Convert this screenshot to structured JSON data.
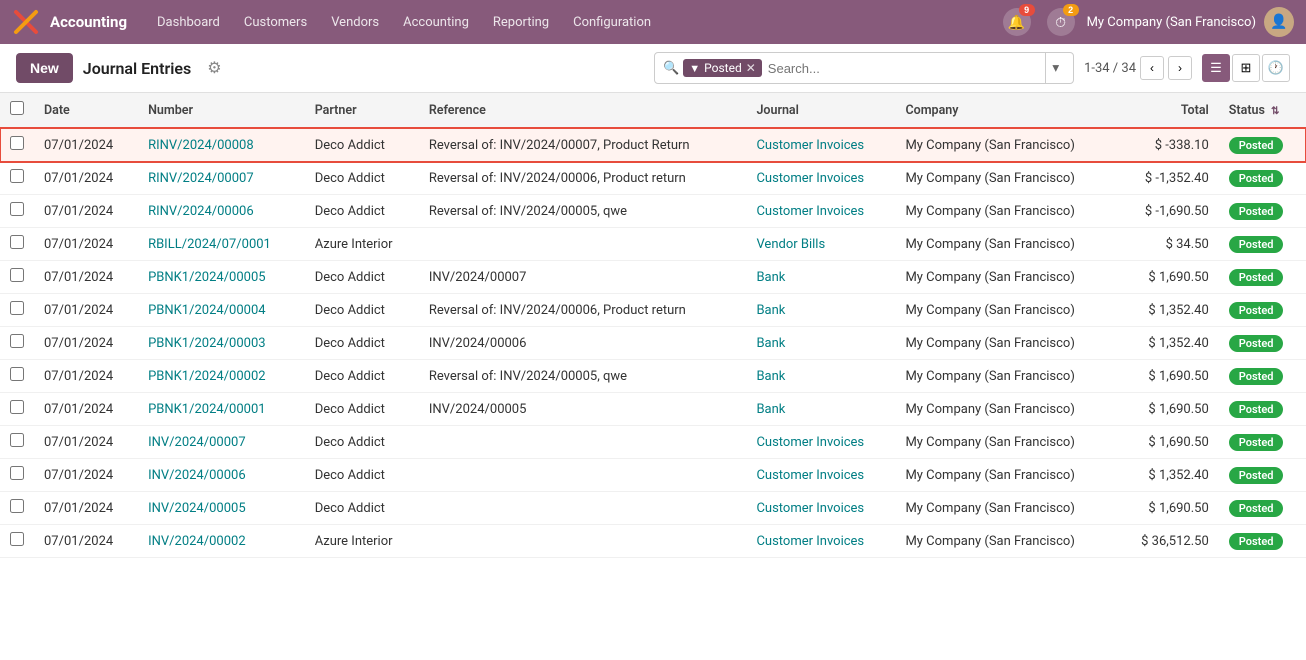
{
  "app": {
    "logo": "X",
    "name": "Accounting"
  },
  "nav": {
    "items": [
      {
        "label": "Dashboard"
      },
      {
        "label": "Customers"
      },
      {
        "label": "Vendors"
      },
      {
        "label": "Accounting"
      },
      {
        "label": "Reporting"
      },
      {
        "label": "Configuration"
      }
    ]
  },
  "topright": {
    "notification_count": "9",
    "timer_count": "2",
    "company": "My Company (San Francisco)"
  },
  "toolbar": {
    "new_label": "New",
    "title": "Journal Entries",
    "filter_label": "Posted",
    "search_placeholder": "Search...",
    "pagination": "1-34 / 34"
  },
  "table": {
    "columns": [
      "Date",
      "Number",
      "Partner",
      "Reference",
      "Journal",
      "Company",
      "Total",
      "Status"
    ],
    "rows": [
      {
        "highlighted": true,
        "date": "07/01/2024",
        "number": "RINV/2024/00008",
        "partner": "Deco Addict",
        "reference": "Reversal of: INV/2024/00007, Product Return",
        "journal": "Customer Invoices",
        "company": "My Company (San Francisco)",
        "total": "$ -338.10",
        "status": "Posted"
      },
      {
        "highlighted": false,
        "date": "07/01/2024",
        "number": "RINV/2024/00007",
        "partner": "Deco Addict",
        "reference": "Reversal of: INV/2024/00006, Product return",
        "journal": "Customer Invoices",
        "company": "My Company (San Francisco)",
        "total": "$ -1,352.40",
        "status": "Posted"
      },
      {
        "highlighted": false,
        "date": "07/01/2024",
        "number": "RINV/2024/00006",
        "partner": "Deco Addict",
        "reference": "Reversal of: INV/2024/00005, qwe",
        "journal": "Customer Invoices",
        "company": "My Company (San Francisco)",
        "total": "$ -1,690.50",
        "status": "Posted"
      },
      {
        "highlighted": false,
        "date": "07/01/2024",
        "number": "RBILL/2024/07/0001",
        "partner": "Azure Interior",
        "reference": "",
        "journal": "Vendor Bills",
        "company": "My Company (San Francisco)",
        "total": "$ 34.50",
        "status": "Posted"
      },
      {
        "highlighted": false,
        "date": "07/01/2024",
        "number": "PBNK1/2024/00005",
        "partner": "Deco Addict",
        "reference": "INV/2024/00007",
        "journal": "Bank",
        "company": "My Company (San Francisco)",
        "total": "$ 1,690.50",
        "status": "Posted"
      },
      {
        "highlighted": false,
        "date": "07/01/2024",
        "number": "PBNK1/2024/00004",
        "partner": "Deco Addict",
        "reference": "Reversal of: INV/2024/00006, Product return",
        "journal": "Bank",
        "company": "My Company (San Francisco)",
        "total": "$ 1,352.40",
        "status": "Posted"
      },
      {
        "highlighted": false,
        "date": "07/01/2024",
        "number": "PBNK1/2024/00003",
        "partner": "Deco Addict",
        "reference": "INV/2024/00006",
        "journal": "Bank",
        "company": "My Company (San Francisco)",
        "total": "$ 1,352.40",
        "status": "Posted"
      },
      {
        "highlighted": false,
        "date": "07/01/2024",
        "number": "PBNK1/2024/00002",
        "partner": "Deco Addict",
        "reference": "Reversal of: INV/2024/00005, qwe",
        "journal": "Bank",
        "company": "My Company (San Francisco)",
        "total": "$ 1,690.50",
        "status": "Posted"
      },
      {
        "highlighted": false,
        "date": "07/01/2024",
        "number": "PBNK1/2024/00001",
        "partner": "Deco Addict",
        "reference": "INV/2024/00005",
        "journal": "Bank",
        "company": "My Company (San Francisco)",
        "total": "$ 1,690.50",
        "status": "Posted"
      },
      {
        "highlighted": false,
        "date": "07/01/2024",
        "number": "INV/2024/00007",
        "partner": "Deco Addict",
        "reference": "",
        "journal": "Customer Invoices",
        "company": "My Company (San Francisco)",
        "total": "$ 1,690.50",
        "status": "Posted"
      },
      {
        "highlighted": false,
        "date": "07/01/2024",
        "number": "INV/2024/00006",
        "partner": "Deco Addict",
        "reference": "",
        "journal": "Customer Invoices",
        "company": "My Company (San Francisco)",
        "total": "$ 1,352.40",
        "status": "Posted"
      },
      {
        "highlighted": false,
        "date": "07/01/2024",
        "number": "INV/2024/00005",
        "partner": "Deco Addict",
        "reference": "",
        "journal": "Customer Invoices",
        "company": "My Company (San Francisco)",
        "total": "$ 1,690.50",
        "status": "Posted"
      },
      {
        "highlighted": false,
        "date": "07/01/2024",
        "number": "INV/2024/00002",
        "partner": "Azure Interior",
        "reference": "",
        "journal": "Customer Invoices",
        "company": "My Company (San Francisco)",
        "total": "$ 36,512.50",
        "status": "Posted"
      }
    ]
  }
}
